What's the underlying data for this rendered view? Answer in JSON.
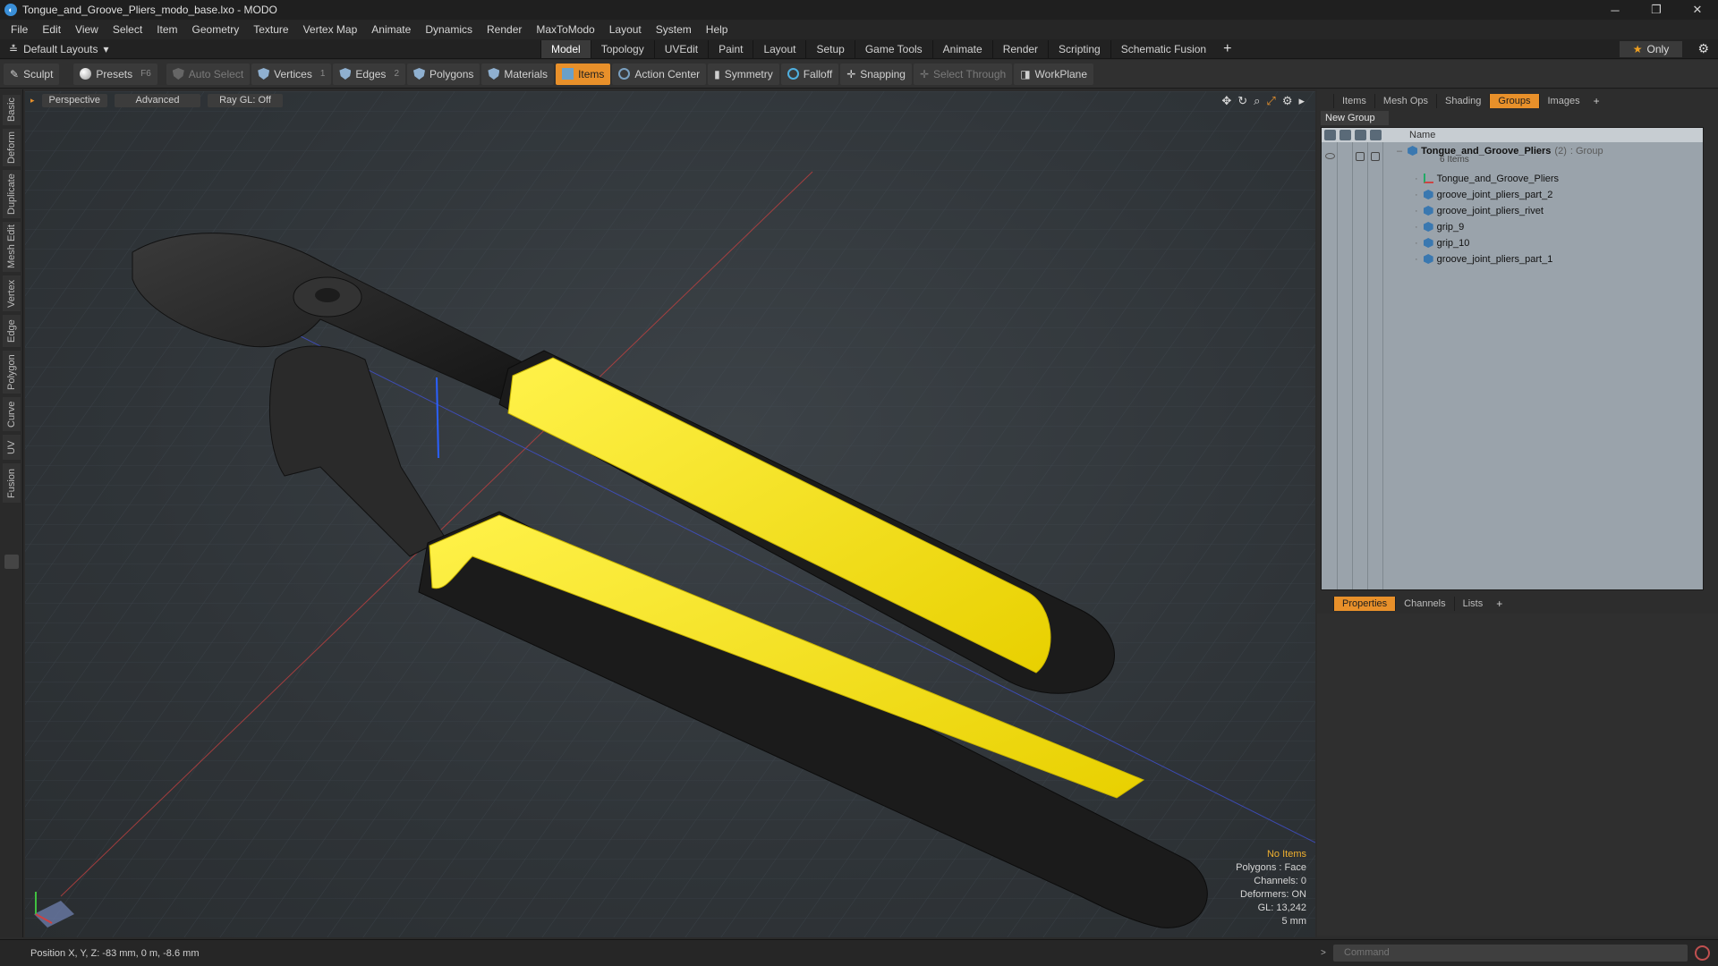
{
  "window": {
    "title": "Tongue_and_Groove_Pliers_modo_base.lxo - MODO",
    "minimize": "─",
    "restore": "❐",
    "close": "✕"
  },
  "menu": [
    "File",
    "Edit",
    "View",
    "Select",
    "Item",
    "Geometry",
    "Texture",
    "Vertex Map",
    "Animate",
    "Dynamics",
    "Render",
    "MaxToModo",
    "Layout",
    "System",
    "Help"
  ],
  "layoutbar": {
    "layout_select": "Default Layouts",
    "tabs": [
      "Model",
      "Topology",
      "UVEdit",
      "Paint",
      "Layout",
      "Setup",
      "Game Tools",
      "Animate",
      "Render",
      "Scripting",
      "Schematic Fusion"
    ],
    "active_tab": "Model",
    "plus": "+",
    "only_label": "Only"
  },
  "toolbar": {
    "sculpt": "Sculpt",
    "presets": "Presets",
    "presets_key": "F6",
    "auto_select": "Auto Select",
    "vertices": "Vertices",
    "vertices_key": "1",
    "edges": "Edges",
    "edges_key": "2",
    "polygons": "Polygons",
    "materials": "Materials",
    "items": "Items",
    "action_center": "Action Center",
    "symmetry": "Symmetry",
    "falloff": "Falloff",
    "snapping": "Snapping",
    "select_through": "Select Through",
    "workplane": "WorkPlane"
  },
  "left_tabs": [
    "Basic",
    "Deform",
    "Duplicate",
    "Mesh Edit",
    "Vertex",
    "Edge",
    "Polygon",
    "Curve",
    "UV",
    "Fusion"
  ],
  "viewport": {
    "view": "Perspective",
    "shading": "Advanced",
    "raygl": "Ray GL: Off",
    "info": {
      "no_items": "No Items",
      "polygons": "Polygons : Face",
      "channels": "Channels: 0",
      "deformers": "Deformers: ON",
      "gl": "GL: 13,242",
      "scale": "5 mm"
    }
  },
  "right_panel": {
    "tabs": [
      "Items",
      "Mesh Ops",
      "Shading",
      "Groups",
      "Images"
    ],
    "active_tab": "Groups",
    "new_group": "New Group",
    "column_name": "Name",
    "group": {
      "name": "Tongue_and_Groove_Pliers",
      "count": "(2)",
      "type": ": Group",
      "items_count": "6 Items"
    },
    "items": [
      {
        "name": "Tongue_and_Groove_Pliers",
        "icon": "locator-icon"
      },
      {
        "name": "groove_joint_pliers_part_2",
        "icon": "mesh-icon"
      },
      {
        "name": "groove_joint_pliers_rivet",
        "icon": "mesh-icon"
      },
      {
        "name": "grip_9",
        "icon": "mesh-icon"
      },
      {
        "name": "grip_10",
        "icon": "mesh-icon"
      },
      {
        "name": "groove_joint_pliers_part_1",
        "icon": "mesh-icon"
      }
    ],
    "props_tabs": [
      "Properties",
      "Channels",
      "Lists"
    ],
    "props_active": "Properties"
  },
  "status": {
    "position": "Position X, Y, Z:  -83 mm, 0 m, -8.6 mm",
    "command_placeholder": "Command"
  },
  "colors": {
    "accent": "#e8902a",
    "grip_yellow": "#f5e41a",
    "rubber_black": "#1a1a1a"
  }
}
